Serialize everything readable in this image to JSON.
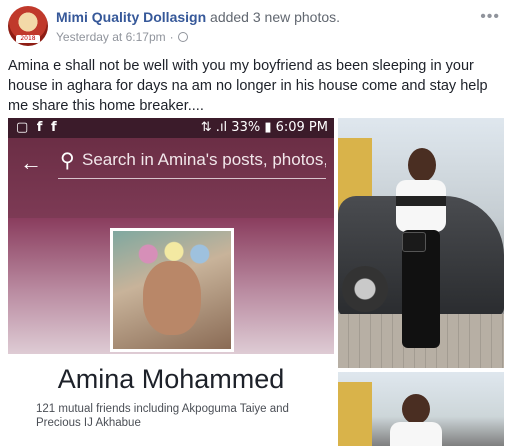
{
  "post": {
    "author": "Mimi Quality Dollasign",
    "action": "added 3 new photos.",
    "timestamp": "Yesterday at 6:17pm",
    "separator": "·",
    "more_menu": "•••",
    "text": "Amina e shall not be well with you my boyfriend as been sleeping in your house in aghara for days na am no longer in his house come and stay help me share this home breaker...."
  },
  "avatar": {
    "badge": "2018"
  },
  "screenshot": {
    "status_left": "▢ f f",
    "status_right": "⇅ .ıl 33% ▮ 6:09 PM",
    "search_placeholder": "Search in Amina's posts, photos, a...",
    "profile_name": "Amina Mohammed",
    "mutual_friends": "121 mutual friends including Akpoguma Taiye and Precious IJ Akhabue"
  },
  "icons": {
    "back": "←",
    "search": "⚲"
  },
  "colors": {
    "author_link": "#365899",
    "meta_gray": "#90949c",
    "cover_purple": "#7d3a55"
  }
}
